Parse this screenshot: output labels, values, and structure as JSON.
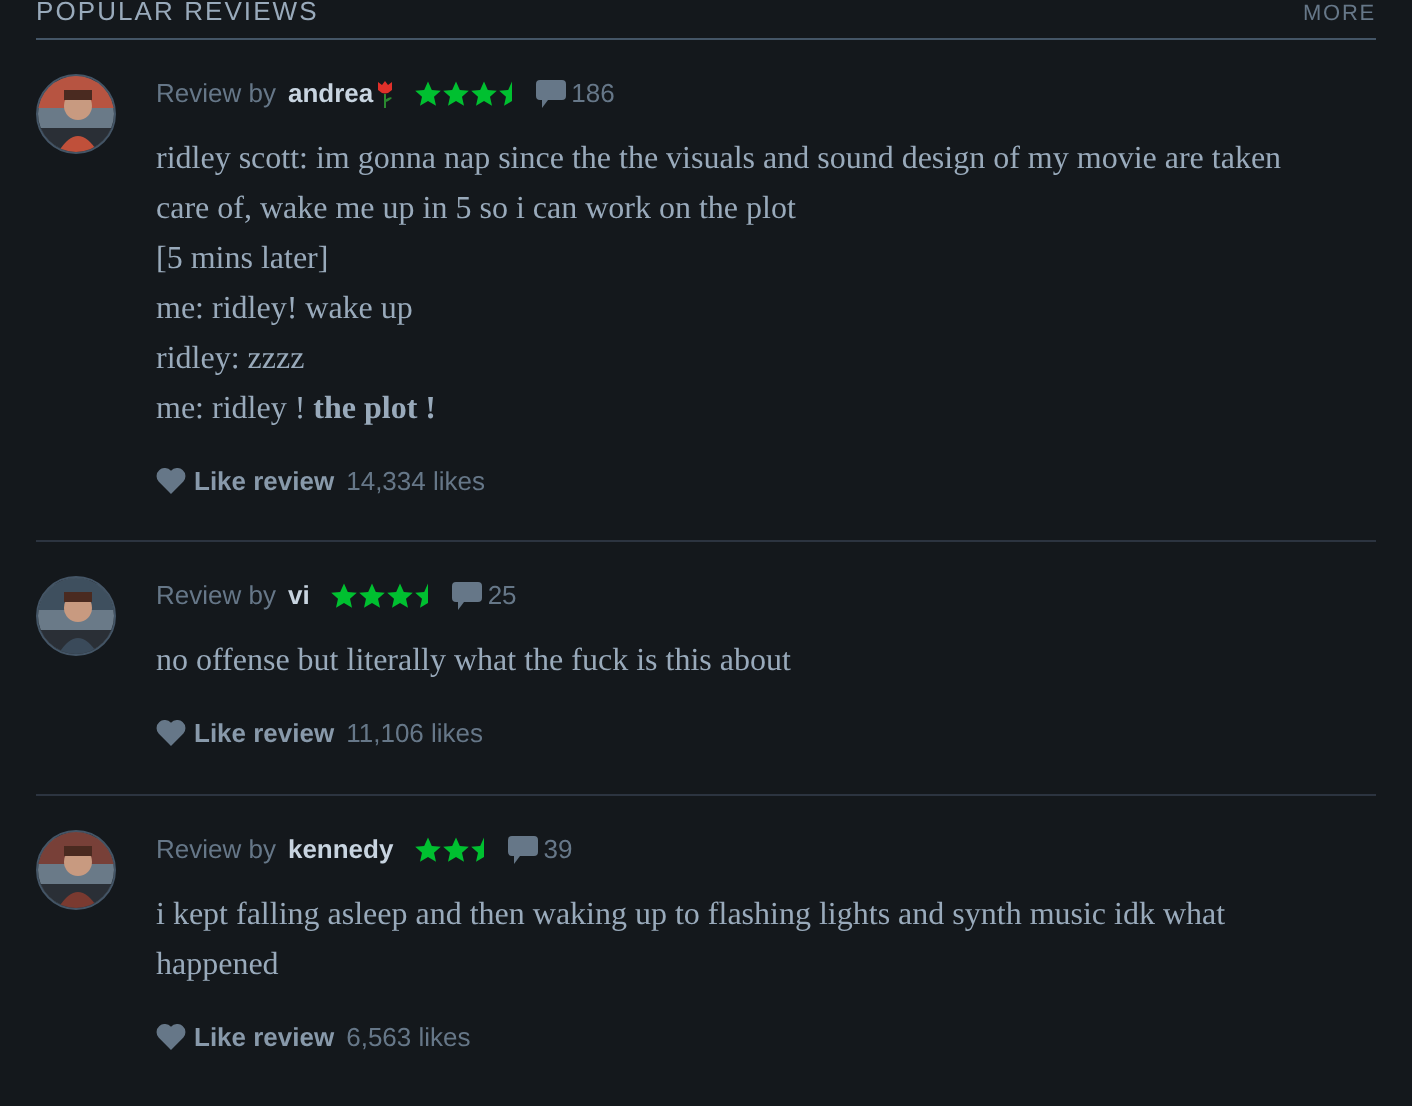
{
  "section": {
    "title": "POPULAR REVIEWS",
    "more_link": "MORE"
  },
  "reviews": [
    {
      "prefix": "Review by",
      "author": "andrea",
      "has_rose": true,
      "stars": 3.5,
      "comments": "186",
      "paragraphs": [
        "ridley scott: im gonna nap since the the visuals and sound design of my movie are taken care of, wake me up in 5 so i can work on the plot",
        "[5 mins later]",
        "me: ridley! wake up",
        "ridley: zzzz",
        "me: ridley ! **the plot !**"
      ],
      "like_label": "Like review",
      "likes": "14,334 likes"
    },
    {
      "prefix": "Review by",
      "author": "vi",
      "has_rose": false,
      "stars": 3.5,
      "comments": "25",
      "paragraphs": [
        "no offense but literally what the fuck is this about"
      ],
      "like_label": "Like review",
      "likes": "11,106 likes"
    },
    {
      "prefix": "Review by",
      "author": "kennedy",
      "has_rose": false,
      "stars": 2.5,
      "comments": "39",
      "paragraphs": [
        "i kept falling asleep and then waking up to flashing lights and synth music idk what happened"
      ],
      "like_label": "Like review",
      "likes": "6,563 likes"
    }
  ]
}
